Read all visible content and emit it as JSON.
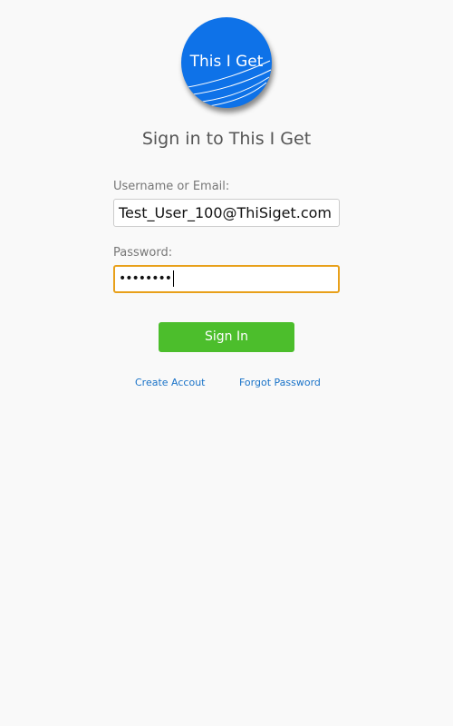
{
  "logo": {
    "text": "This I Get",
    "color": "#0e72e8"
  },
  "title": "Sign in to This I Get",
  "form": {
    "username_label": "Username or Email:",
    "username_value": "Test_User_100@ThiSiget.com",
    "password_label": "Password:",
    "password_value": "••••••••"
  },
  "actions": {
    "signin_label": "Sign In",
    "create_account_label": "Create Accout",
    "forgot_password_label": "Forgot Password"
  },
  "colors": {
    "signin_button": "#4cbe2c",
    "link": "#1a73c8",
    "focus_border": "#e8a01a"
  }
}
